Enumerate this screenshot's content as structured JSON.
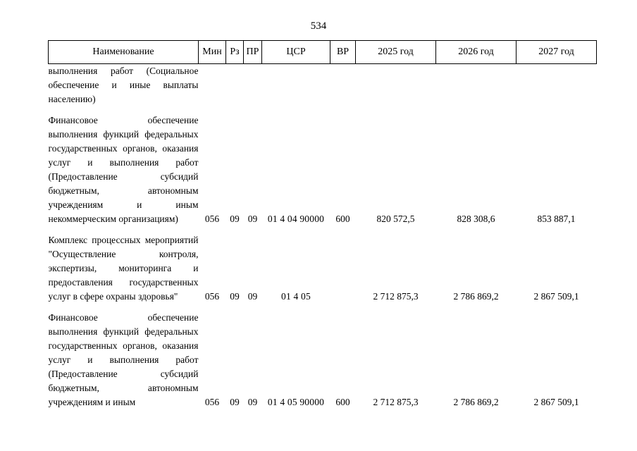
{
  "document": {
    "page_number": "534"
  },
  "table": {
    "headers": [
      "Наименование",
      "Мин",
      "Рз",
      "ПР",
      "ЦСР",
      "ВР",
      "2025 год",
      "2026 год",
      "2027 год"
    ],
    "rows": [
      {
        "name": "выполнения работ (Социальное обеспечение и иные выплаты населению)",
        "min": "",
        "rz": "",
        "pr": "",
        "csr": "",
        "vr": "",
        "y2025": "",
        "y2026": "",
        "y2027": ""
      },
      {
        "name": "Финансовое обеспечение выполнения функций федеральных государственных органов, оказания услуг и выполнения работ (Предоставление субсидий бюджетным, автономным учреждениям и иным некоммерческим организациям)",
        "min": "056",
        "rz": "09",
        "pr": "09",
        "csr": "01 4 04 90000",
        "vr": "600",
        "y2025": "820 572,5",
        "y2026": "828 308,6",
        "y2027": "853 887,1"
      },
      {
        "name": "Комплекс процессных мероприятий \"Осуществление контроля, экспертизы, мониторинга и предоставления государственных услуг в сфере охраны здоровья\"",
        "min": "056",
        "rz": "09",
        "pr": "09",
        "csr": "01 4 05",
        "vr": "",
        "y2025": "2 712 875,3",
        "y2026": "2 786 869,2",
        "y2027": "2 867 509,1"
      },
      {
        "name": "Финансовое обеспечение выполнения функций федеральных государственных органов, оказания услуг и выполнения работ (Предоставление субсидий бюджетным, автономным учреждениям и иным",
        "min": "056",
        "rz": "09",
        "pr": "09",
        "csr": "01 4 05 90000",
        "vr": "600",
        "y2025": "2 712 875,3",
        "y2026": "2 786 869,2",
        "y2027": "2 867 509,1"
      }
    ]
  }
}
